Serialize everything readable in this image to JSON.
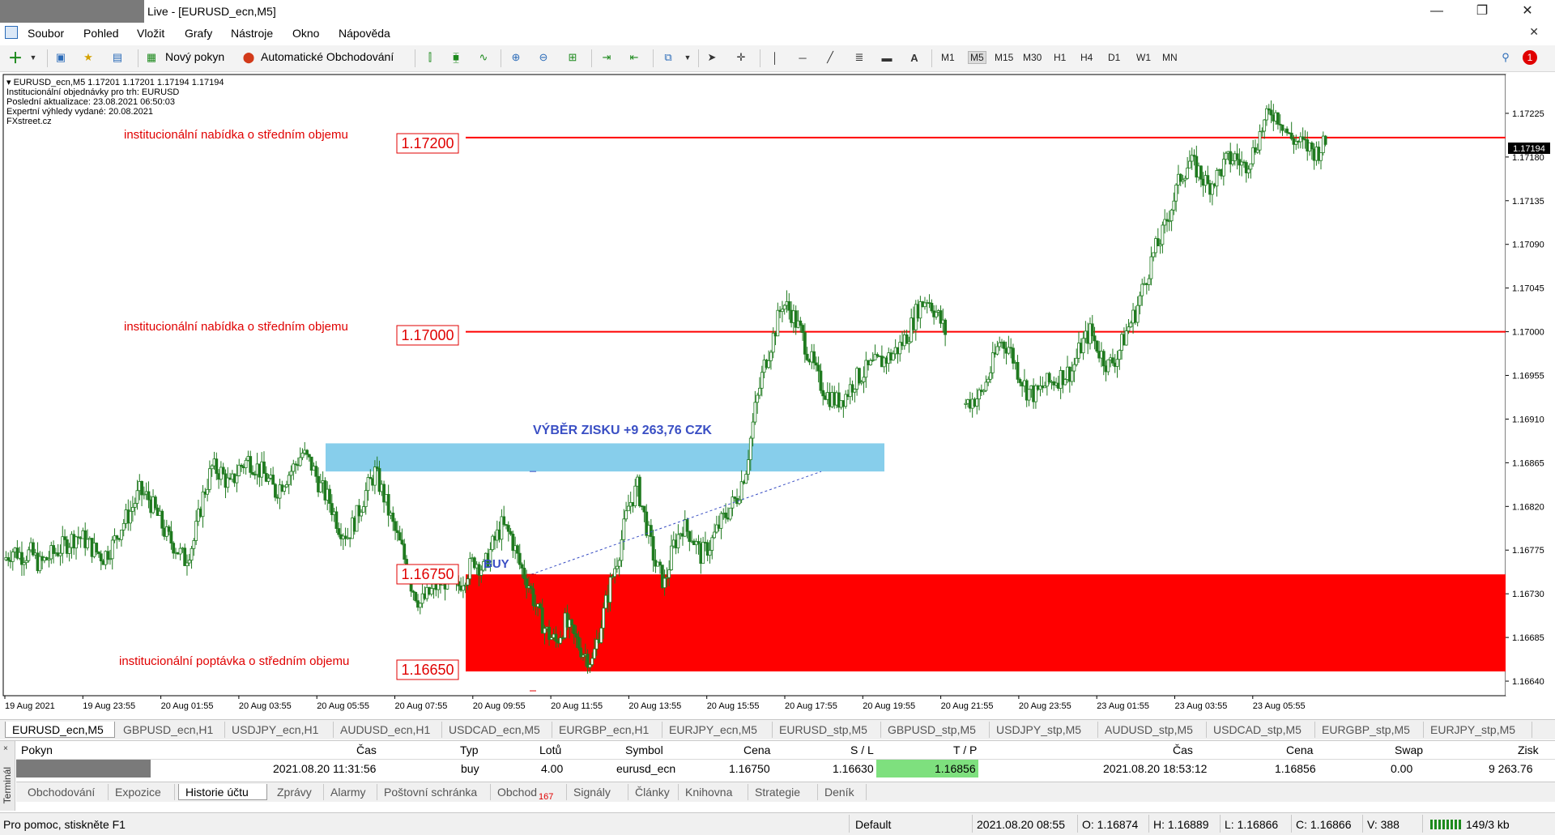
{
  "window": {
    "title": "Live - [EURUSD_ecn,M5]",
    "minimize": "—",
    "restore": "❐",
    "close": "✕"
  },
  "menu": [
    "Soubor",
    "Pohled",
    "Vložit",
    "Grafy",
    "Nástroje",
    "Okno",
    "Nápověda"
  ],
  "toolbar": {
    "new_order": "Nový pokyn",
    "auto_trading": "Automatické Obchodování",
    "timeframes": [
      "M1",
      "M5",
      "M15",
      "M30",
      "H1",
      "H4",
      "D1",
      "W1",
      "MN"
    ],
    "active_timeframe": "M5",
    "notification_count": "1"
  },
  "chart": {
    "header_line": "EURUSD_ecn,M5  1.17201 1.17201 1.17194 1.17194",
    "info_lines": [
      "Institucionální objednávky pro trh: EURUSD",
      "Poslední aktualizace: 23.08.2021 06:50:03",
      "Expertní výhledy vydané: 20.08.2021",
      "FXstreet.cz"
    ],
    "level_labels": {
      "top": "institucionální nabídka o středním objemu",
      "middle": "institucionální nabídka o středním objemu",
      "bottom": "institucionální poptávka o středním objemu"
    },
    "price_tags": [
      "1.17200",
      "1.17000",
      "1.16750",
      "1.16650"
    ],
    "profit_label": "VÝBĚR ZISKU +9 263,76 CZK",
    "buy_label": "BUY",
    "current_price_tag": "1.17194",
    "colors": {
      "level_line": "#ff0000",
      "demand_zone": "#ff0000",
      "profit_zone": "#87ceeb",
      "label_text": "#e00000",
      "annotation_blue": "#3a4fc4",
      "candles": "#1f7a1f"
    }
  },
  "chart_data": {
    "type": "candlestick",
    "symbol": "EURUSD_ecn",
    "timeframe": "M5",
    "ohlc_last": {
      "open": 1.17201,
      "high": 1.17201,
      "low": 1.17194,
      "close": 1.17194
    },
    "ylim": [
      1.16625,
      1.17265
    ],
    "y_ticks": [
      "1.17225",
      "1.17180",
      "1.17135",
      "1.17090",
      "1.17045",
      "1.17000",
      "1.16955",
      "1.16910",
      "1.16865",
      "1.16820",
      "1.16775",
      "1.16730",
      "1.16685",
      "1.16640"
    ],
    "x_ticks": [
      "19 Aug 2021",
      "19 Aug 23:55",
      "20 Aug 01:55",
      "20 Aug 03:55",
      "20 Aug 05:55",
      "20 Aug 07:55",
      "20 Aug 09:55",
      "20 Aug 11:55",
      "20 Aug 13:55",
      "20 Aug 15:55",
      "20 Aug 17:55",
      "20 Aug 19:55",
      "20 Aug 21:55",
      "20 Aug 23:55",
      "23 Aug 01:55",
      "23 Aug 03:55",
      "23 Aug 05:55"
    ],
    "horizontal_levels": [
      1.172,
      1.17
    ],
    "zones": [
      {
        "name": "demand",
        "from": 1.1665,
        "to": 1.1675
      },
      {
        "name": "take-profit",
        "from": 1.16856,
        "to": 1.16885
      }
    ],
    "trade": {
      "entry": 1.1675,
      "exit": 1.16856
    },
    "path": [
      1.16765,
      1.16775,
      1.1677,
      1.16772,
      1.1676,
      1.16768,
      1.16775,
      1.16782,
      1.1679,
      1.16785,
      1.16775,
      1.16768,
      1.1678,
      1.168,
      1.16815,
      1.16835,
      1.16828,
      1.1681,
      1.1679,
      1.16778,
      1.16765,
      1.16785,
      1.1683,
      1.1686,
      1.16855,
      1.1684,
      1.1686,
      1.16868,
      1.1686,
      1.1685,
      1.16835,
      1.16848,
      1.1686,
      1.16875,
      1.16862,
      1.1684,
      1.16825,
      1.168,
      1.1679,
      1.1681,
      1.16835,
      1.16855,
      1.1683,
      1.168,
      1.16775,
      1.1674,
      1.1672,
      1.1673,
      1.1674,
      1.16745,
      1.16735,
      1.1675,
      1.16765,
      1.16755,
      1.1678,
      1.168,
      1.1679,
      1.1676,
      1.1674,
      1.1671,
      1.1669,
      1.1668,
      1.167,
      1.16685,
      1.1667,
      1.1666,
      1.167,
      1.1674,
      1.16775,
      1.1682,
      1.1684,
      1.168,
      1.1676,
      1.1674,
      1.1678,
      1.168,
      1.1679,
      1.1677,
      1.1678,
      1.168,
      1.16815,
      1.1683,
      1.1686,
      1.1692,
      1.16965,
      1.16995,
      1.1703,
      1.1702,
      1.17,
      1.16975,
      1.1695,
      1.16935,
      1.16928,
      1.16935,
      1.1695,
      1.16958,
      1.16965,
      1.1697,
      1.16975,
      1.16985,
      1.17,
      1.17025,
      1.17035,
      1.1702,
      1.17,
      null,
      1.16925,
      1.1693,
      1.16935,
      1.1696,
      1.1699,
      1.16985,
      1.1696,
      1.1694,
      1.16935,
      1.16945,
      1.1695,
      1.16955,
      1.1696,
      1.16985,
      1.17,
      1.1698,
      1.16965,
      1.16975,
      1.17,
      1.1702,
      1.1705,
      1.1708,
      1.171,
      1.1713,
      1.1716,
      1.17175,
      1.17165,
      1.1715,
      1.1716,
      1.17175,
      1.1718,
      1.1717,
      1.17185,
      1.1721,
      1.17228,
      1.1722,
      1.172,
      1.17195,
      1.1719,
      1.17185,
      1.17194
    ]
  },
  "symbol_tabs": [
    "EURUSD_ecn,M5",
    "GBPUSD_ecn,H1",
    "USDJPY_ecn,H1",
    "AUDUSD_ecn,H1",
    "USDCAD_ecn,M5",
    "EURGBP_ecn,H1",
    "EURJPY_ecn,M5",
    "EURUSD_stp,M5",
    "GBPUSD_stp,M5",
    "USDJPY_stp,M5",
    "AUDUSD_stp,M5",
    "USDCAD_stp,M5",
    "EURGBP_stp,M5",
    "EURJPY_stp,M5"
  ],
  "terminal": {
    "side_label": "Terminál",
    "close": "×",
    "headers": {
      "order": "Pokyn",
      "time": "Čas",
      "type": "Typ",
      "lots": "Lotů",
      "symbol": "Symbol",
      "price": "Cena",
      "sl": "S / L",
      "tp": "T / P",
      "close_time": "Čas",
      "close_price": "Cena",
      "swap": "Swap",
      "profit": "Zisk"
    },
    "row": {
      "time": "2021.08.20 11:31:56",
      "type": "buy",
      "lots": "4.00",
      "symbol": "eurusd_ecn",
      "price": "1.16750",
      "sl": "1.16630",
      "tp": "1.16856",
      "close_time": "2021.08.20 18:53:12",
      "close_price": "1.16856",
      "swap": "0.00",
      "profit": "9 263.76"
    },
    "tabs": [
      "Obchodování",
      "Expozice",
      "Historie účtu",
      "Zprávy",
      "Alarmy",
      "Poštovní schránka",
      "Obchod",
      "Signály",
      "Články",
      "Knihovna",
      "Strategie",
      "Deník"
    ],
    "active_tab": "Historie účtu",
    "trade_badge": "167"
  },
  "status": {
    "help": "Pro pomoc, stiskněte F1",
    "profile": "Default",
    "datetime": "2021.08.20 08:55",
    "open": "O: 1.16874",
    "high": "H: 1.16889",
    "low": "L: 1.16866",
    "close": "C: 1.16866",
    "volume": "V: 388",
    "traffic": "149/3 kb"
  }
}
